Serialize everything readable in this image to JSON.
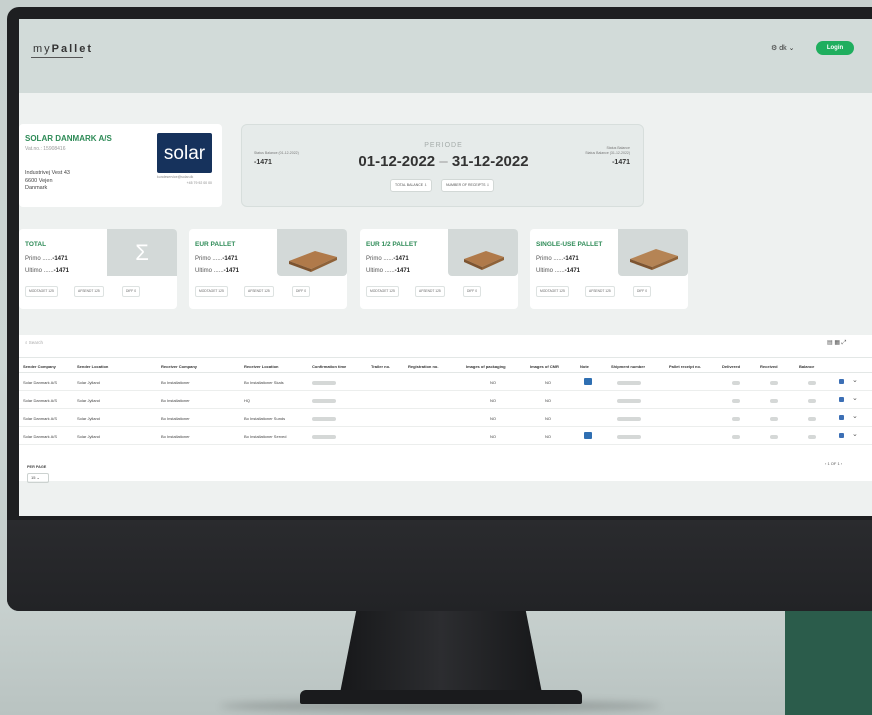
{
  "app": {
    "logo": {
      "prefix": "my",
      "bold": "Pallet"
    },
    "lang": "⚙ dk",
    "lang_chevron": "⌄",
    "login_label": "Login"
  },
  "company": {
    "name": "SOLAR DANMARK A/S",
    "vat": "Vat.no.: 15908416",
    "address_line1": "Industrivej Vest 43",
    "address_line2": "6600 Vejen",
    "address_line3": "Danmark",
    "logo_text": "solar",
    "contact_note": "kundeservice@solar.dk",
    "phone": "+45 79 92 00 00"
  },
  "period": {
    "label": "PERIODE",
    "start": "01-12-2022",
    "separator": "–",
    "end": "31-12-2022",
    "status_left_label": "Status Balance (01-12-2022)",
    "status_left_value": "-1471",
    "status_right_label_top": "Status Balance",
    "status_right_label_bottom": "Status Balance (31-12-2022)",
    "status_right_value": "-1471",
    "btn_total_balance": "TOTAL BALANCE ⇩",
    "btn_receipts": "NUMBER OF RECEIPTS ⇩"
  },
  "cards": [
    {
      "title": "TOTAL",
      "primo_label": "Primo ......",
      "primo": "-1471",
      "ultimo_label": "Ultimo ......",
      "ultimo": "-1471",
      "b1": "MODTAGET  125",
      "b2": "AFSENDT  125",
      "b3": "DIFF  0"
    },
    {
      "title": "EUR PALLET",
      "primo_label": "Primo ......",
      "primo": "-1471",
      "ultimo_label": "Ultimo ......",
      "ultimo": "-1471",
      "b1": "MODTAGET  125",
      "b2": "AFSENDT  125",
      "b3": "DIFF  0"
    },
    {
      "title": "EUR 1/2 PALLET",
      "primo_label": "Primo ......",
      "primo": "-1471",
      "ultimo_label": "Ultimo ......",
      "ultimo": "-1471",
      "b1": "MODTAGET  125",
      "b2": "AFSENDT  125",
      "b3": "DIFF  0"
    },
    {
      "title": "SINGLE-USE PALLET",
      "primo_label": "Primo ......",
      "primo": "-1471",
      "ultimo_label": "Ultimo ......",
      "ultimo": "-1471",
      "b1": "MODTAGET  125",
      "b2": "AFSENDT  125",
      "b3": "DIFF  0"
    }
  ],
  "table": {
    "search_placeholder": "Search",
    "toolbar_icons": "▤ ▦ ⤢",
    "columns": [
      "Sender Company",
      "Sender Location",
      "Receiver Company",
      "Receiver Location",
      "Confirmation time",
      "Trailer no.",
      "Registration no.",
      "Images of packaging",
      "Images of CMR",
      "Note",
      "Shipment number",
      "Pallet receipt no.",
      "Delivered",
      "Received",
      "Balance"
    ],
    "rows": [
      {
        "sender": "Solar Danmark A/S",
        "sender_loc": "Solar Jylland",
        "receiver": "Bo Installationer",
        "receiver_loc": "Bo Installationer Skals",
        "img_pack": "NO",
        "img_cmr": "NO"
      },
      {
        "sender": "Solar Danmark A/S",
        "sender_loc": "Solar Jylland",
        "receiver": "Bo Installationer",
        "receiver_loc": "HQ",
        "img_pack": "NO",
        "img_cmr": "NO"
      },
      {
        "sender": "Solar Danmark A/S",
        "sender_loc": "Solar Jylland",
        "receiver": "Bo Installationer",
        "receiver_loc": "Bo Installationer Sunds",
        "img_pack": "NO",
        "img_cmr": "NO"
      },
      {
        "sender": "Solar Danmark A/S",
        "sender_loc": "Solar Jylland",
        "receiver": "Bo Installationer",
        "receiver_loc": "Bo Installationer Served",
        "img_pack": "NO",
        "img_cmr": "NO"
      }
    ],
    "per_page_label": "PER PAGE",
    "per_page_value": "15  ⌄",
    "pager": "‹  1 OF 1  ›"
  },
  "colors": {
    "accent": "#1fae5e",
    "title_green": "#2e8b57",
    "solar_blue": "#16325c",
    "note_blue": "#2f6fb2"
  }
}
